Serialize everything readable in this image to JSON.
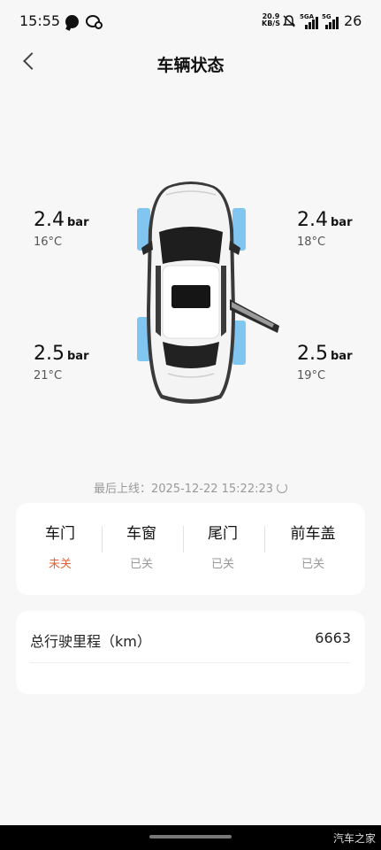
{
  "status_bar": {
    "time": "15:55",
    "net_speed_value": "20.9",
    "net_speed_unit": "KB/S",
    "sim1_label": "5GA",
    "sim2_label": "5G",
    "battery": "26"
  },
  "header": {
    "title": "车辆状态"
  },
  "tires": {
    "front_left": {
      "pressure": "2.4",
      "unit": "bar",
      "temp": "16°C"
    },
    "front_right": {
      "pressure": "2.4",
      "unit": "bar",
      "temp": "18°C"
    },
    "rear_left": {
      "pressure": "2.5",
      "unit": "bar",
      "temp": "21°C"
    },
    "rear_right": {
      "pressure": "2.5",
      "unit": "bar",
      "temp": "19°C"
    }
  },
  "last_online": "最后上线：2025-12-22 15:22:23",
  "status_items": [
    {
      "name": "车门",
      "state": "未关",
      "open": true
    },
    {
      "name": "车窗",
      "state": "已关",
      "open": false
    },
    {
      "name": "尾门",
      "state": "已关",
      "open": false
    },
    {
      "name": "前车盖",
      "state": "已关",
      "open": false
    }
  ],
  "mileage": {
    "label": "总行驶里程（km）",
    "value": "6663"
  },
  "watermark": "汽车之家",
  "colors": {
    "open_state": "#e5633a",
    "closed_state": "#999999",
    "tire_highlight": "#5ab4ef"
  }
}
